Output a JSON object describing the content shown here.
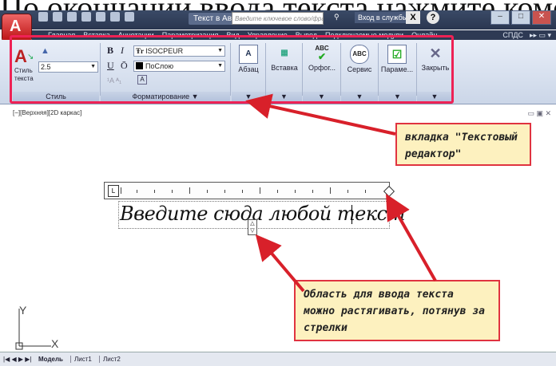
{
  "caption": "По окончании ввода текста нажмите комо",
  "titlebar": {
    "doc_title": "Текст в Авт...",
    "search_placeholder": "Введите ключевое слово/фразу",
    "login": "Вход в службы",
    "x_label": "X",
    "help_label": "?"
  },
  "menu": {
    "items": [
      "Главная",
      "Вставка",
      "Аннотации",
      "Параметризация",
      "Вид",
      "Управление",
      "Вывод",
      "Подключаемые модули",
      "Онлайн"
    ],
    "right": "СПДС",
    "right_extra": "▸▸ ▭ ▾"
  },
  "ribbon": {
    "style_btn": "Стиль текста",
    "height_value": "2.5",
    "font_value": "ISOCPEUR",
    "layer_value": "ПоСлою",
    "bold": "B",
    "italic": "I",
    "underline": "U",
    "overline": "Ō",
    "panel_style": "Стиль",
    "panel_format": "Форматирование ▼",
    "paragraph": "Абзац",
    "insert": "Вставка",
    "spell": "Орфог...",
    "tools": "Сервис",
    "options": "Параме...",
    "close": "Закрыть",
    "abc": "ABC",
    "abc2": "ABC",
    "dd": "▼"
  },
  "viewport": {
    "label": "[−][Верхняя][2D каркас]",
    "input_text": "Введите сюда любой текст",
    "axis_y": "Y",
    "axis_x": "X"
  },
  "callouts": {
    "tab": "вкладка \"Текстовый редактор\"",
    "area": "Область для ввода текста можно растягивать, потянув за стрелки"
  },
  "tabs": {
    "nav": "|◀ ◀ ▶ ▶|",
    "model": "Модель",
    "sheet1": "Лист1",
    "sheet2": "Лист2"
  }
}
